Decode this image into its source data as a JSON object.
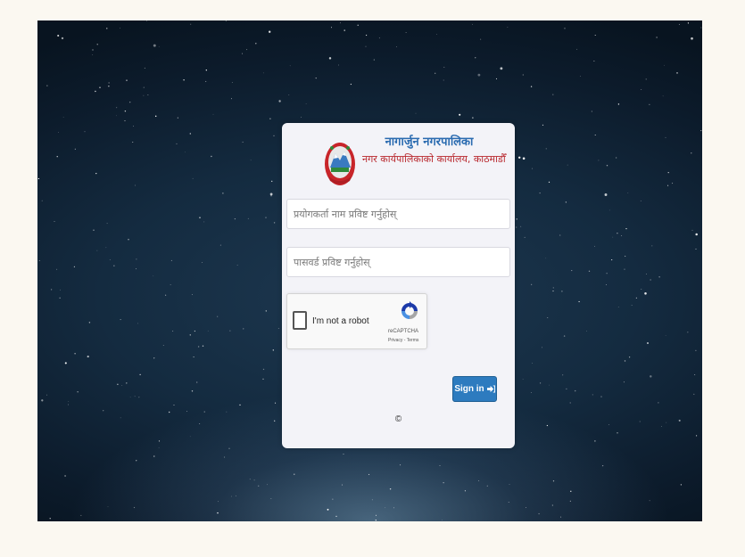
{
  "header": {
    "org_name": "नागार्जुन नगरपालिका",
    "office_name": "नगर कार्यपालिकाको कार्यालय, काठमाडौँ",
    "emblem_icon": "nepal-government-emblem"
  },
  "form": {
    "username_placeholder": "प्रयोगकर्ता नाम प्रविष्ट गर्नुहोस्",
    "username_value": "",
    "password_placeholder": "पासवर्ड प्रविष्ट गर्नुहोस्",
    "password_value": "",
    "sign_in_label": "Sign in",
    "sign_in_icon": "sign-in-icon"
  },
  "recaptcha": {
    "label": "I'm not a robot",
    "brand": "reCAPTCHA",
    "links": "Privacy - Terms",
    "checked": false
  },
  "footer": {
    "copyright": "©"
  },
  "colors": {
    "page_bg": "#fbf8f1",
    "card_bg": "#f3f3f8",
    "title_blue": "#2a6bb0",
    "subtitle_red": "#b8262c",
    "button_blue": "#2d7bbf"
  }
}
